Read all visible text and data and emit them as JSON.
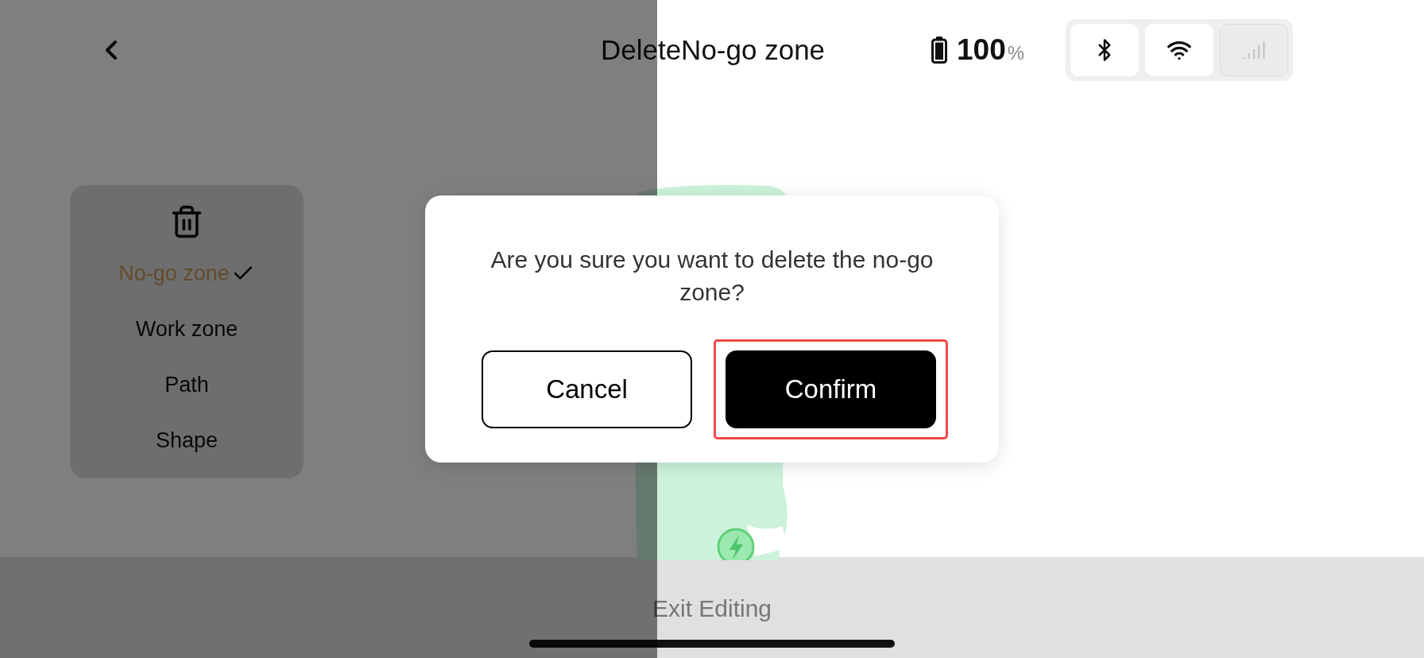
{
  "header": {
    "title": "DeleteNo-go zone",
    "battery": {
      "value": "100",
      "unit": "%"
    },
    "status_icons": [
      {
        "kind": "bluetooth",
        "disabled": false
      },
      {
        "kind": "wifi",
        "disabled": false
      },
      {
        "kind": "signal",
        "disabled": true
      }
    ]
  },
  "zone_menu": {
    "items": [
      {
        "label": "No-go zone",
        "selected": true
      },
      {
        "label": "Work zone",
        "selected": false
      },
      {
        "label": "Path",
        "selected": false
      },
      {
        "label": "Shape",
        "selected": false
      }
    ]
  },
  "dialog": {
    "message": "Are you sure you want to delete the no-go zone?",
    "buttons": [
      {
        "label": "Cancel",
        "kind": "secondary",
        "highlighted": false
      },
      {
        "label": "Confirm",
        "kind": "primary",
        "highlighted": true
      }
    ]
  },
  "bottom_bar": {
    "label": "Exit Editing"
  }
}
